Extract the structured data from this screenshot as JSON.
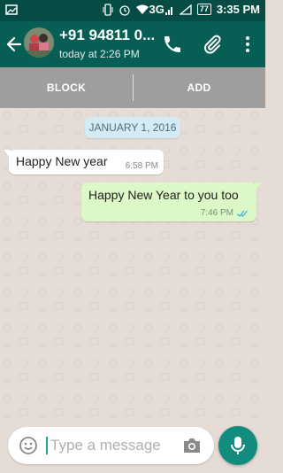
{
  "status_bar": {
    "network_label": "3G",
    "battery_level": "77",
    "time": "3:35 PM",
    "icons": [
      "image-notification-icon",
      "vibrate-icon",
      "alarm-icon",
      "wifi-icon",
      "signal-icon",
      "signal-empty-icon",
      "battery-icon"
    ]
  },
  "header": {
    "contact_name": "+91 94811 0...",
    "last_seen": "today at 2:26 PM",
    "icons": [
      "back-arrow-icon",
      "call-icon",
      "attach-icon",
      "more-icon"
    ]
  },
  "actions": {
    "block_label": "BLOCK",
    "add_label": "ADD"
  },
  "chat": {
    "date_chip": "JANUARY 1, 2016",
    "messages": [
      {
        "direction": "incoming",
        "text": "Happy New year",
        "time": "6:58 PM"
      },
      {
        "direction": "outgoing",
        "text": "Happy New Year to you too",
        "time": "7:46 PM",
        "status": "read"
      }
    ]
  },
  "composer": {
    "placeholder": "Type a message",
    "value": ""
  },
  "colors": {
    "status_bar": "#054d44",
    "app_bar": "#075e54",
    "action_bar": "#9e9e9e",
    "chat_background": "#e5ddd5",
    "outgoing_bubble": "#dcf8c6",
    "date_chip": "#d4eaf4",
    "mic_button": "#128c7e",
    "read_receipt": "#34b7f1"
  }
}
